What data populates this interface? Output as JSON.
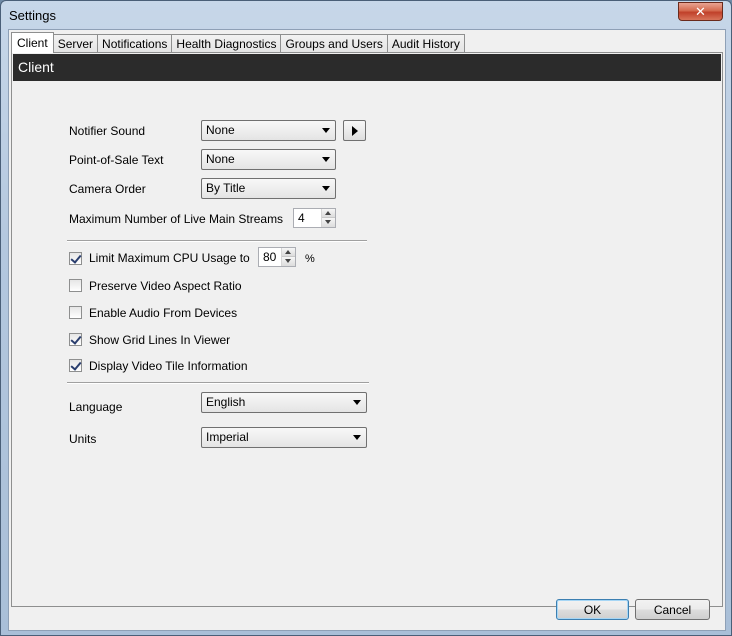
{
  "window": {
    "title": "Settings",
    "close_glyph": "✕"
  },
  "tabs": [
    "Client",
    "Server",
    "Notifications",
    "Health Diagnostics",
    "Groups and Users",
    "Audit History"
  ],
  "header": {
    "title": "Client"
  },
  "fields": {
    "notifier_sound": {
      "label": "Notifier Sound",
      "value": "None"
    },
    "pos_text": {
      "label": "Point-of-Sale Text",
      "value": "None"
    },
    "camera_order": {
      "label": "Camera Order",
      "value": "By Title"
    },
    "max_streams": {
      "label": "Maximum Number of Live Main Streams",
      "value": "4"
    }
  },
  "options": {
    "limit_cpu": {
      "label": "Limit Maximum CPU Usage to",
      "checked": true,
      "value": "80",
      "unit": "%"
    },
    "preserve_aspect": {
      "label": "Preserve Video Aspect Ratio",
      "checked": false
    },
    "enable_audio": {
      "label": "Enable Audio From Devices",
      "checked": false
    },
    "grid_lines": {
      "label": "Show Grid Lines In Viewer",
      "checked": true
    },
    "tile_info": {
      "label": "Display Video Tile Information",
      "checked": true
    }
  },
  "locale": {
    "language": {
      "label": "Language",
      "value": "English"
    },
    "units": {
      "label": "Units",
      "value": "Imperial"
    }
  },
  "buttons": {
    "ok": "OK",
    "cancel": "Cancel"
  }
}
